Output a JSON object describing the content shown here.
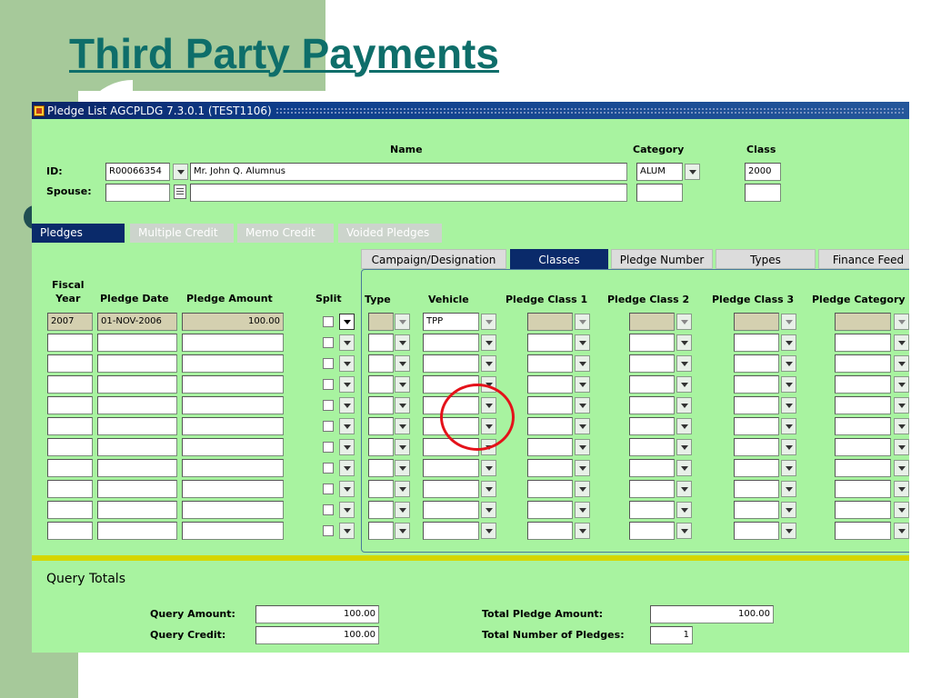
{
  "slide": {
    "title": "Third Party Payments"
  },
  "window": {
    "title": "Pledge List  AGCPLDG  7.3.0.1  (TEST1106)"
  },
  "header": {
    "labels": {
      "id": "ID:",
      "spouse": "Spouse:",
      "name": "Name",
      "category": "Category",
      "class": "Class"
    },
    "values": {
      "id": "R00066354",
      "name": "Mr. John Q. Alumnus",
      "category": "ALUM",
      "class": "2000",
      "spouse_id": "",
      "spouse_name": "",
      "spouse_category": "",
      "spouse_class": ""
    }
  },
  "main_tabs": [
    "Pledges",
    "Multiple Credit",
    "Memo Credit",
    "Voided Pledges"
  ],
  "sub_tabs": [
    "Campaign/Designation",
    "Classes",
    "Pledge Number",
    "Types",
    "Finance Feed"
  ],
  "columns": {
    "fiscal_year": "Fiscal\nYear",
    "pledge_date": "Pledge Date",
    "pledge_amount": "Pledge Amount",
    "split": "Split",
    "type": "Type",
    "vehicle": "Vehicle",
    "pledge_class_1": "Pledge Class 1",
    "pledge_class_2": "Pledge Class 2",
    "pledge_class_3": "Pledge Class 3",
    "pledge_category": "Pledge Category"
  },
  "rows": [
    {
      "fiscal_year": "2007",
      "pledge_date": "01-NOV-2006",
      "pledge_amount": "100.00",
      "vehicle": "TPP"
    },
    {
      "fiscal_year": "",
      "pledge_date": "",
      "pledge_amount": "",
      "vehicle": ""
    },
    {
      "fiscal_year": "",
      "pledge_date": "",
      "pledge_amount": "",
      "vehicle": ""
    },
    {
      "fiscal_year": "",
      "pledge_date": "",
      "pledge_amount": "",
      "vehicle": ""
    },
    {
      "fiscal_year": "",
      "pledge_date": "",
      "pledge_amount": "",
      "vehicle": ""
    },
    {
      "fiscal_year": "",
      "pledge_date": "",
      "pledge_amount": "",
      "vehicle": ""
    },
    {
      "fiscal_year": "",
      "pledge_date": "",
      "pledge_amount": "",
      "vehicle": ""
    },
    {
      "fiscal_year": "",
      "pledge_date": "",
      "pledge_amount": "",
      "vehicle": ""
    },
    {
      "fiscal_year": "",
      "pledge_date": "",
      "pledge_amount": "",
      "vehicle": ""
    },
    {
      "fiscal_year": "",
      "pledge_date": "",
      "pledge_amount": "",
      "vehicle": ""
    },
    {
      "fiscal_year": "",
      "pledge_date": "",
      "pledge_amount": "",
      "vehicle": ""
    }
  ],
  "query_totals": {
    "title": "Query Totals",
    "query_amount_label": "Query Amount:",
    "query_amount": "100.00",
    "query_credit_label": "Query Credit:",
    "query_credit": "100.00",
    "total_pledge_amount_label": "Total Pledge Amount:",
    "total_pledge_amount": "100.00",
    "total_number_label": "Total Number of Pledges:",
    "total_number": "1"
  },
  "icons": {
    "window": "form-icon",
    "dropdown": "chevron-down-icon",
    "note": "note-icon"
  },
  "colors": {
    "form_bg": "#a8f3a0",
    "title_text": "#0e6e6a",
    "active_tab": "#0a2a6a",
    "highlight": "#e4121a"
  }
}
